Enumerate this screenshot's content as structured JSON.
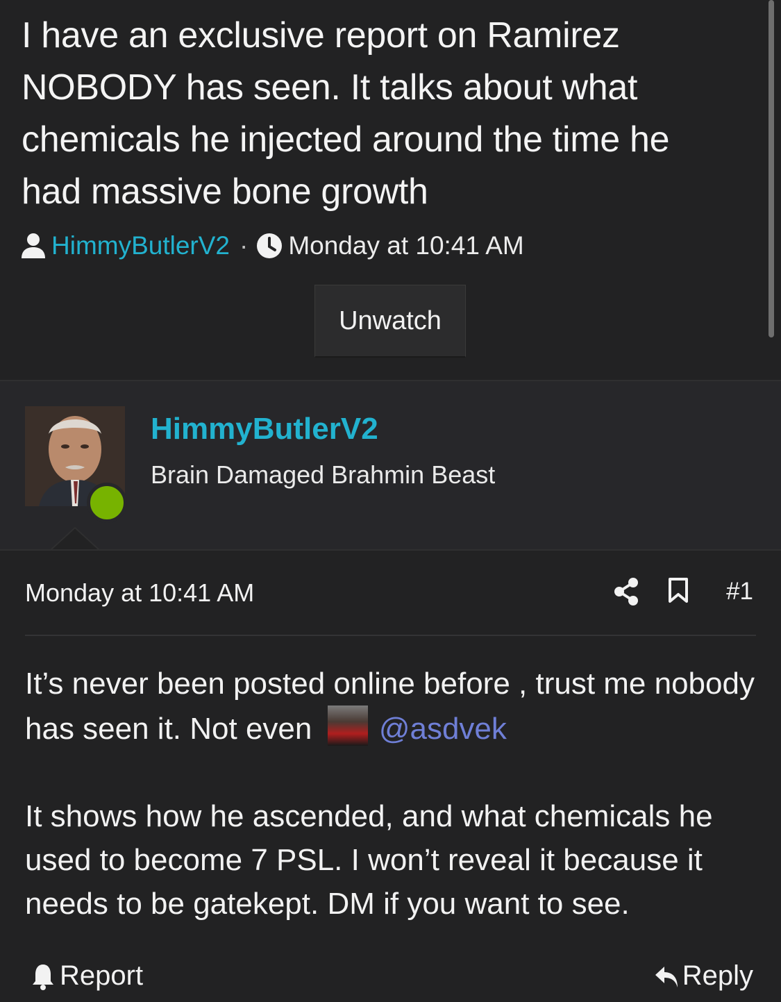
{
  "thread": {
    "title": "I have an exclusive report on Ramirez NOBODY has seen. It talks about what chemicals he injected around the time he had massive bone growth",
    "author": "HimmyButlerV2",
    "separator": "·",
    "date": "Monday at 10:41 AM",
    "unwatch_label": "Unwatch"
  },
  "user": {
    "name": "HimmyButlerV2",
    "title": "Brain Damaged Brahmin Beast"
  },
  "post": {
    "date": "Monday at 10:41 AM",
    "number": "#1",
    "paragraph1_text": "It’s never been posted online before , trust me nobody has seen it. Not even",
    "mention": "@asdvek",
    "paragraph2": "It shows how he ascended, and what chemicals he used to become 7 PSL. I won’t reveal it because it needs to be gatekept. DM if you want to see.",
    "report_label": "Report",
    "reply_label": "Reply"
  },
  "colors": {
    "background": "#222223",
    "link": "#22b2cf",
    "mention": "#6f7fd6",
    "online": "#77b300"
  }
}
